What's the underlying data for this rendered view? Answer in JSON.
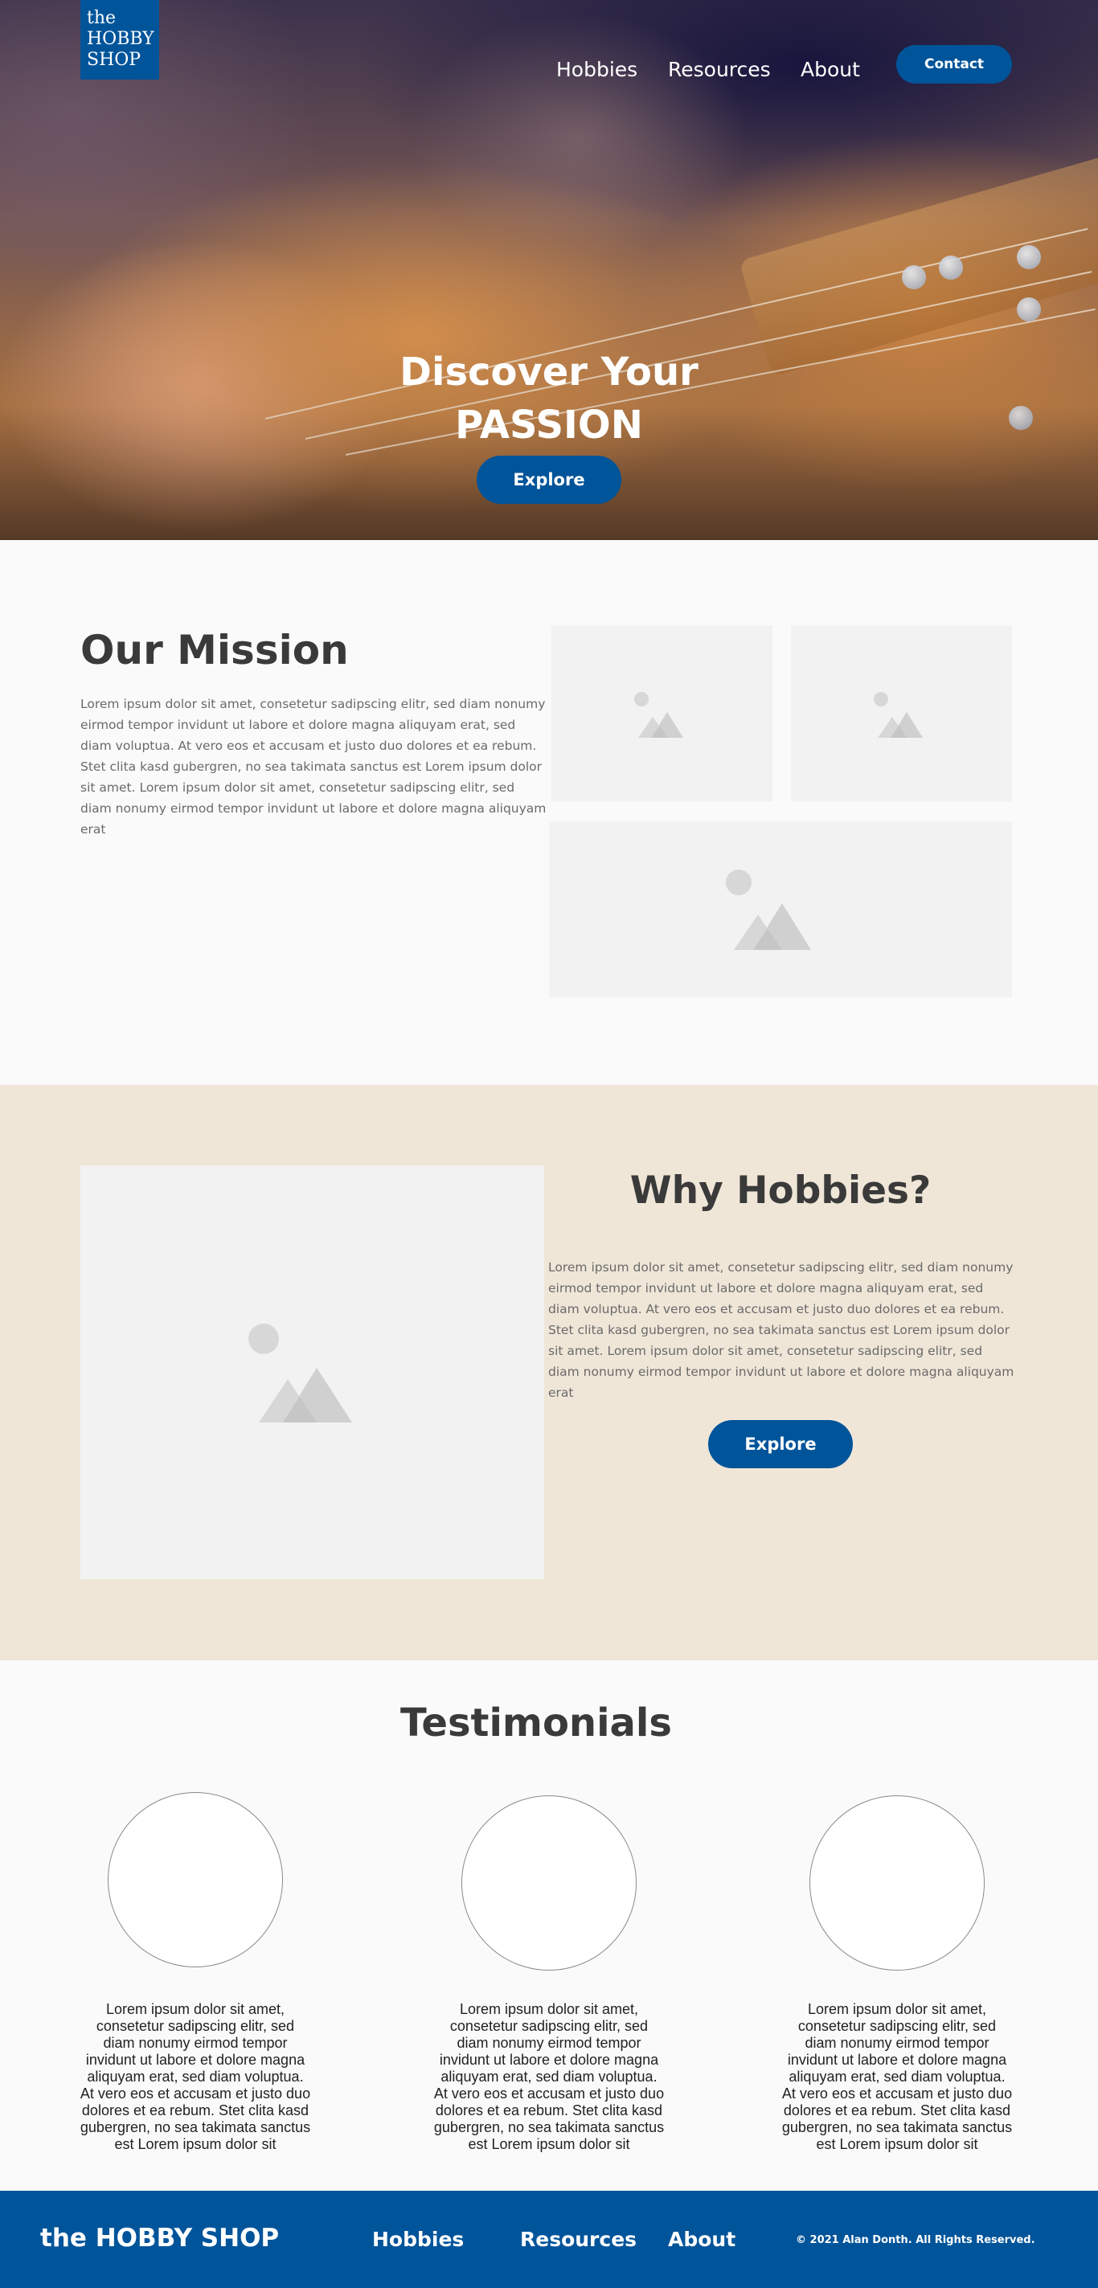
{
  "brand": {
    "logo_line1": "the",
    "logo_line2": "HOBBY",
    "logo_line3": "SHOP",
    "color": "#00549a"
  },
  "nav": {
    "items": [
      {
        "label": "Hobbies"
      },
      {
        "label": "Resources"
      },
      {
        "label": "About"
      }
    ],
    "contact_label": "Contact"
  },
  "hero": {
    "title_line1": "Discover Your",
    "title_line2": "PASSION",
    "cta_label": "Explore",
    "background": "guitar-playing-photo"
  },
  "mission": {
    "title": "Our Mission",
    "body": "Lorem ipsum dolor sit amet, consetetur sadipscing elitr, sed diam nonumy eirmod tempor invidunt ut labore et dolore magna aliquyam erat, sed diam voluptua. At vero eos et accusam et justo duo dolores et ea rebum. Stet clita kasd gubergren, no sea takimata sanctus est Lorem ipsum dolor sit amet. Lorem ipsum dolor sit amet, consetetur sadipscing elitr, sed diam nonumy eirmod tempor invidunt ut labore et dolore magna aliquyam erat",
    "images": [
      "image-placeholder-icon",
      "image-placeholder-icon",
      "image-placeholder-icon"
    ]
  },
  "why": {
    "title": "Why Hobbies?",
    "body": "Lorem ipsum dolor sit amet, consetetur sadipscing elitr, sed diam nonumy eirmod tempor invidunt ut labore et dolore magna aliquyam erat, sed diam voluptua. At vero eos et accusam et justo duo dolores et ea rebum. Stet clita kasd gubergren, no sea takimata sanctus est Lorem ipsum dolor sit amet. Lorem ipsum dolor sit amet, consetetur sadipscing elitr, sed diam nonumy eirmod tempor invidunt ut labore et dolore magna aliquyam erat",
    "cta_label": "Explore",
    "background": "#efe6d8"
  },
  "testimonials": {
    "title": "Testimonials",
    "items": [
      {
        "text": "Lorem ipsum dolor sit amet, consetetur sadipscing elitr, sed diam nonumy eirmod tempor invidunt ut labore et dolore magna aliquyam erat, sed diam voluptua. At vero eos et accusam et justo duo dolores et ea rebum. Stet clita kasd gubergren, no sea takimata sanctus est Lorem ipsum dolor sit"
      },
      {
        "text": "Lorem ipsum dolor sit amet, consetetur sadipscing elitr, sed diam nonumy eirmod tempor invidunt ut labore et dolore magna aliquyam erat, sed diam voluptua. At vero eos et accusam et justo duo dolores et ea rebum. Stet clita kasd gubergren, no sea takimata sanctus est Lorem ipsum dolor sit"
      },
      {
        "text": "Lorem ipsum dolor sit amet, consetetur sadipscing elitr, sed diam nonumy eirmod tempor invidunt ut labore et dolore magna aliquyam erat, sed diam voluptua. At vero eos et accusam et justo duo dolores et ea rebum. Stet clita kasd gubergren, no sea takimata sanctus est Lorem ipsum dolor sit"
      }
    ]
  },
  "footer": {
    "brand": "the HOBBY SHOP",
    "links": [
      {
        "label": "Hobbies"
      },
      {
        "label": "Resources"
      },
      {
        "label": "About"
      }
    ],
    "copyright": "© 2021 Alan Donth.  All Rights Reserved."
  }
}
